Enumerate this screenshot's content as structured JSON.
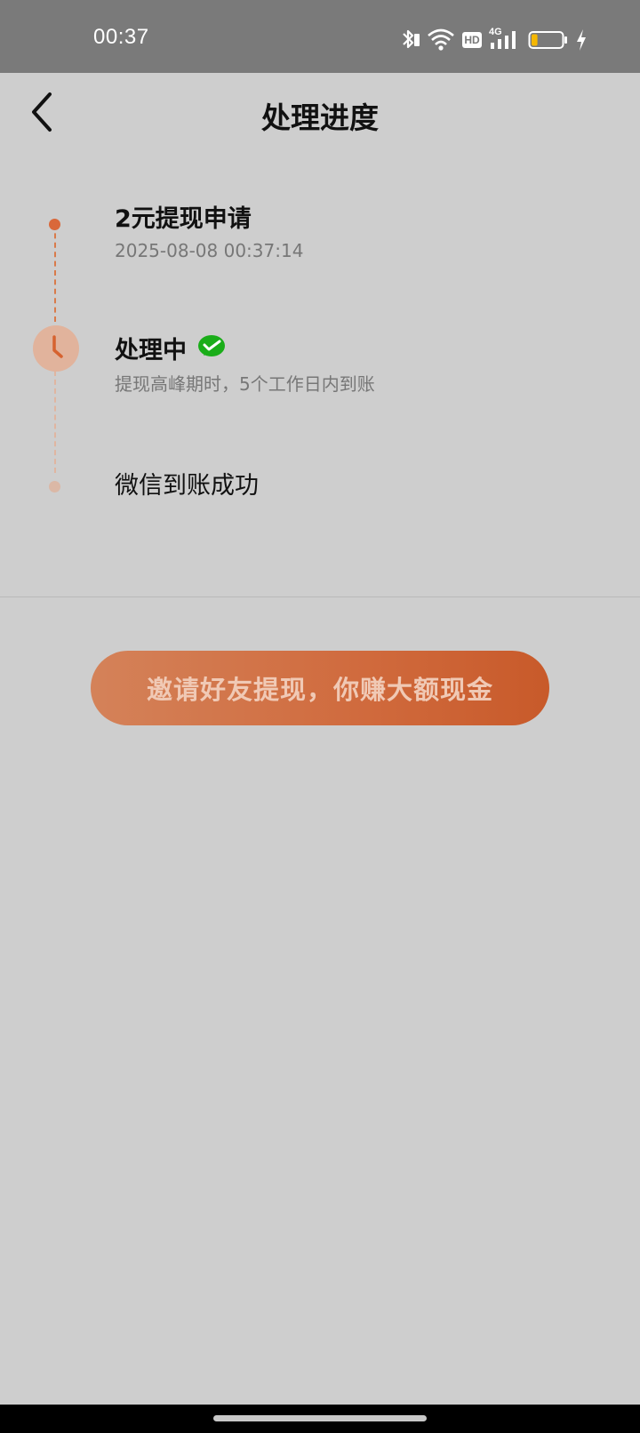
{
  "status_bar": {
    "time": "00:37",
    "icons": [
      "bluetooth-icon",
      "wifi-icon",
      "hd-icon",
      "signal-4g-icon",
      "battery-icon",
      "charging-icon"
    ],
    "network_label": "4G",
    "hd_label": "HD",
    "battery_level": 0.2
  },
  "header": {
    "title": "处理进度",
    "back_icon": "chevron-left-icon"
  },
  "timeline": {
    "steps": [
      {
        "title": "2元提现申请",
        "subtitle": "2025-08-08 00:37:14",
        "state": "done"
      },
      {
        "title": "处理中",
        "subtitle": "提现高峰期时，5个工作日内到账",
        "state": "current",
        "badge_icon": "wechat-pay-icon"
      },
      {
        "title": "微信到账成功",
        "subtitle": "",
        "state": "pending"
      }
    ]
  },
  "cta": {
    "label": "邀请好友提现，你赚大额现金"
  },
  "colors": {
    "accent": "#d9683a",
    "background": "#cecece",
    "status_bar": "#7a7a7a",
    "wechat_green": "#1aad19"
  }
}
